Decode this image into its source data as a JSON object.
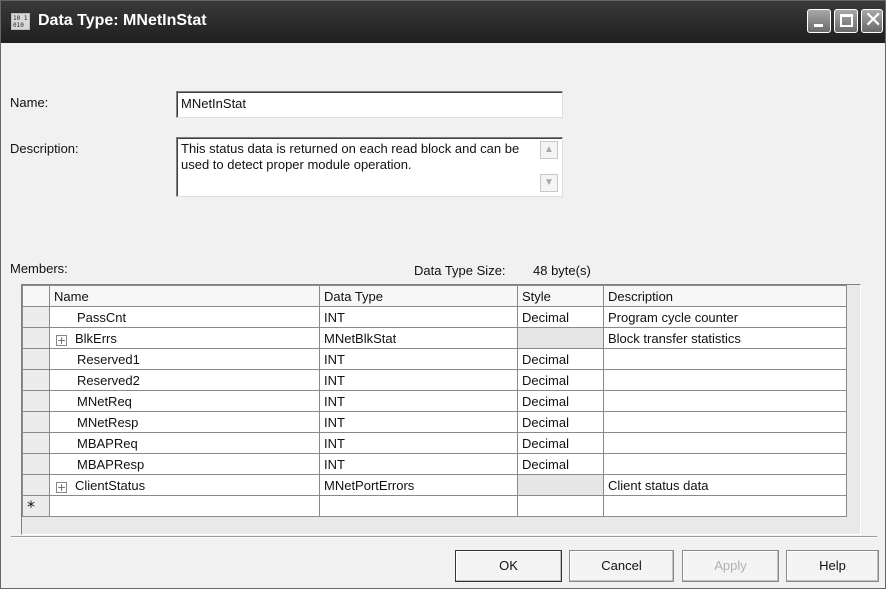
{
  "window": {
    "title": "Data Type:  MNetInStat",
    "icon": "data-type-icon",
    "icon_text": "10 1\n010"
  },
  "form": {
    "name_label": "Name:",
    "name_value": "MNetInStat",
    "description_label": "Description:",
    "description_value": "This status data is returned on each read block and can be used to detect proper module operation."
  },
  "members": {
    "label": "Members:",
    "size_label": "Data Type Size:",
    "size_value": "48 byte(s)",
    "columns": [
      "Name",
      "Data Type",
      "Style",
      "Description"
    ],
    "rows": [
      {
        "expandable": false,
        "name": "PassCnt",
        "type": "INT",
        "style": "Decimal",
        "desc": "Program cycle counter"
      },
      {
        "expandable": true,
        "name": "BlkErrs",
        "type": "MNetBlkStat",
        "style": "",
        "desc": "Block transfer statistics"
      },
      {
        "expandable": false,
        "name": "Reserved1",
        "type": "INT",
        "style": "Decimal",
        "desc": ""
      },
      {
        "expandable": false,
        "name": "Reserved2",
        "type": "INT",
        "style": "Decimal",
        "desc": ""
      },
      {
        "expandable": false,
        "name": "MNetReq",
        "type": "INT",
        "style": "Decimal",
        "desc": ""
      },
      {
        "expandable": false,
        "name": "MNetResp",
        "type": "INT",
        "style": "Decimal",
        "desc": ""
      },
      {
        "expandable": false,
        "name": "MBAPReq",
        "type": "INT",
        "style": "Decimal",
        "desc": ""
      },
      {
        "expandable": false,
        "name": "MBAPResp",
        "type": "INT",
        "style": "Decimal",
        "desc": ""
      },
      {
        "expandable": true,
        "name": "ClientStatus",
        "type": "MNetPortErrors",
        "style": "",
        "desc": "Client status data"
      }
    ],
    "new_row_marker": "*"
  },
  "buttons": {
    "ok": "OK",
    "cancel": "Cancel",
    "apply": "Apply",
    "help": "Help"
  },
  "colors": {
    "titlebar": "#2b2b2b",
    "disabled_text": "#b0b0b0"
  }
}
